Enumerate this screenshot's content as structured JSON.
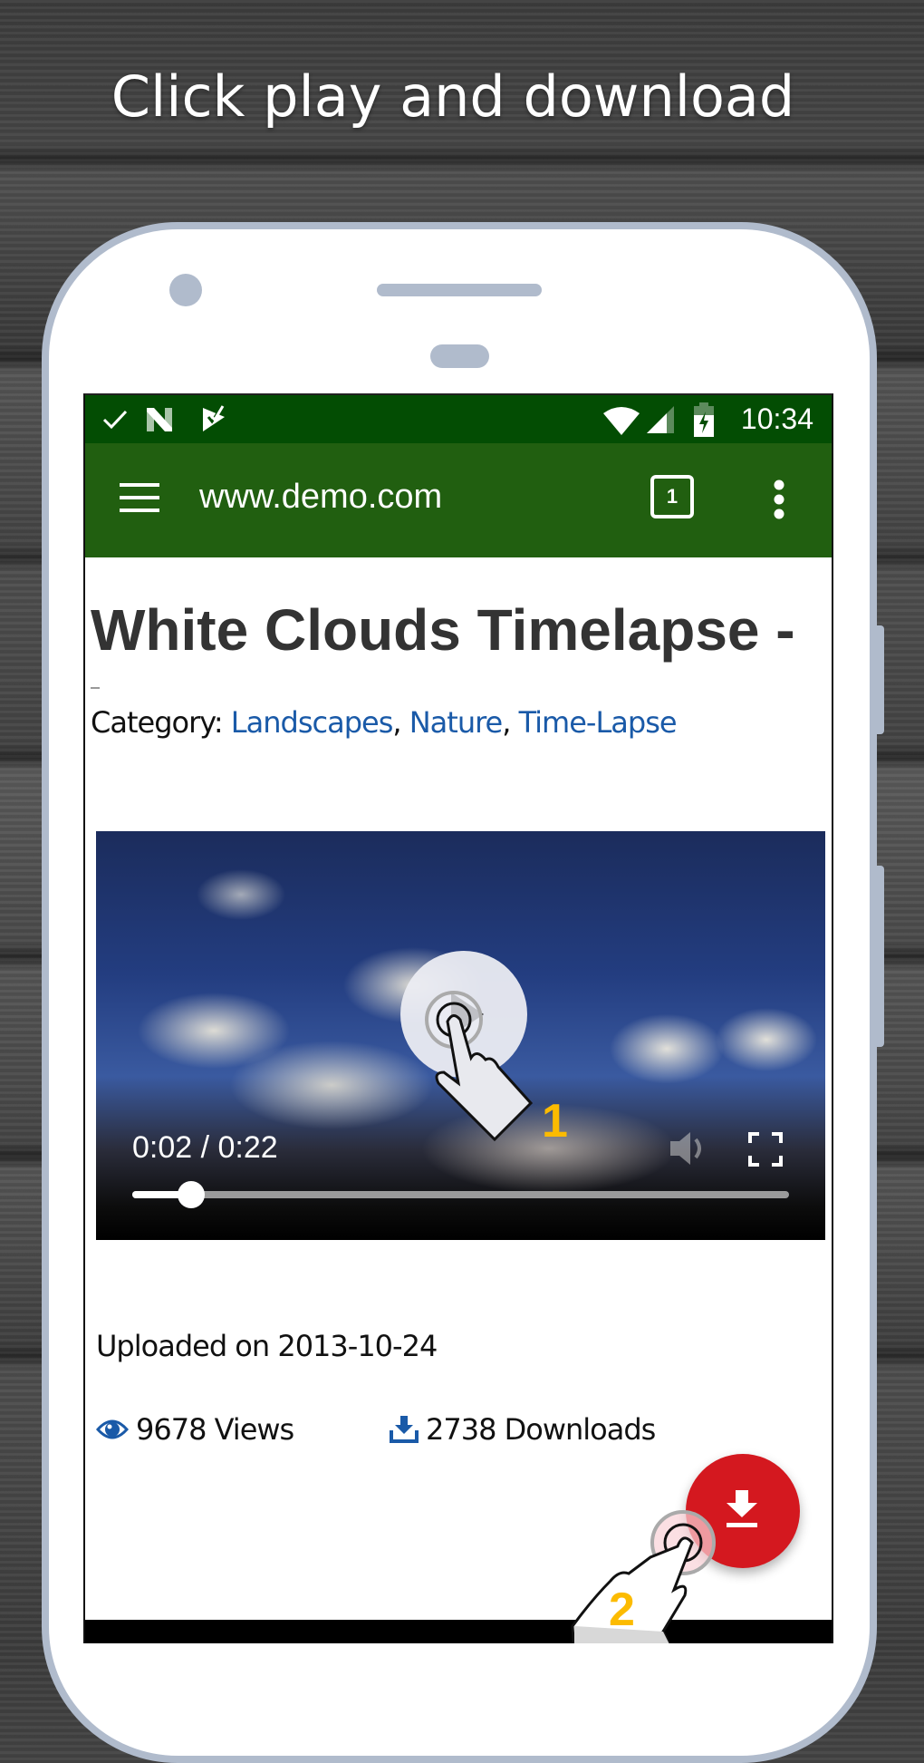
{
  "caption": "Click play and download",
  "status_bar": {
    "time": "10:34",
    "left_icons": [
      "check-icon",
      "n-app-icon",
      "task-check-icon"
    ],
    "right_icons": [
      "wifi-icon",
      "signal-icon",
      "battery-charging-icon"
    ]
  },
  "toolbar": {
    "url": "www.demo.com",
    "tab_count": "1",
    "menu_icon": "hamburger-icon",
    "overflow_icon": "more-vert-icon"
  },
  "page": {
    "title": "White Clouds Timelapse -",
    "category_label": "Category: ",
    "categories": [
      "Landscapes",
      "Nature",
      "Time-Lapse"
    ],
    "separator": ", ",
    "uploaded": "Uploaded on 2013-10-24",
    "views": "9678 Views",
    "downloads": "2738 Downloads"
  },
  "video": {
    "time_readout": "0:02 / 0:22",
    "progress": 0.09
  },
  "colors": {
    "status_bar": "#034d03",
    "toolbar": "#215f10",
    "link": "#1a5aa8",
    "fab": "#d4181f",
    "step_number": "#fcbb00",
    "phone_frame": "#b0bbcc"
  },
  "annotations": {
    "step1": "1",
    "step2": "2"
  }
}
